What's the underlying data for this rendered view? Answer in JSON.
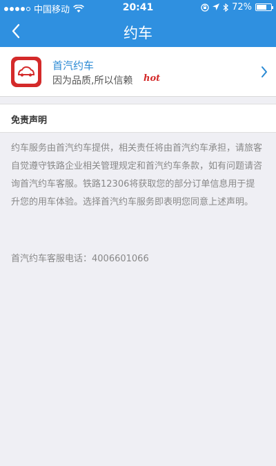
{
  "status_bar": {
    "carrier": "中国移动",
    "time": "20:41",
    "battery": "72%",
    "battery_level": 0.72,
    "icons": [
      "signal-dots-icon",
      "wifi-icon",
      "rotation-lock-icon",
      "location-icon",
      "bluetooth-icon",
      "battery-icon"
    ]
  },
  "nav": {
    "title": "约车",
    "back_icon": "chevron-left-icon"
  },
  "service": {
    "name": "首汽约车",
    "slogan": "因为品质,所以信赖",
    "badge": "hot",
    "logo_icon": "car-logo-icon",
    "arrow_icon": "chevron-right-icon"
  },
  "disclaimer": {
    "title": "免责声明",
    "body": "约车服务由首汽约车提供，相关责任将由首汽约车承担，请旅客自觉遵守铁路企业相关管理规定和首汽约车条款，如有问题请咨询首汽约车客服。铁路12306将获取您的部分订单信息用于提升您的用车体验。选择首汽约车服务即表明您同意上述声明。",
    "phone": "首汽约车客服电话：4006601066"
  },
  "colors": {
    "accent": "#2f90e0",
    "link": "#2a8ad4",
    "brand_red": "#d42a2a",
    "background": "#efeff4"
  }
}
